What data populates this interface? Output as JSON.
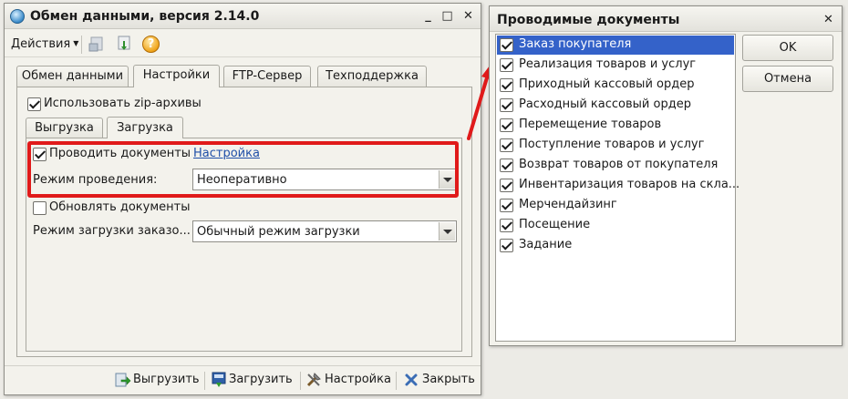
{
  "main_window": {
    "title": "Обмен данными, версия 2.14.0",
    "title_buttons": {
      "minimize": "_",
      "maximize": "□",
      "close": "✕"
    },
    "toolbar": {
      "actions_label": "Действия",
      "help_symbol": "?"
    },
    "tabs": [
      {
        "label": "Обмен данными"
      },
      {
        "label": "Настройки",
        "active": true
      },
      {
        "label": "FTP-Сервер"
      },
      {
        "label": "Техподдержка"
      }
    ],
    "use_zip": {
      "label": "Использовать zip-архивы",
      "checked": true
    },
    "subtabs": [
      {
        "label": "Выгрузка"
      },
      {
        "label": "Загрузка",
        "active": true
      }
    ],
    "post_documents": {
      "label": "Проводить документы",
      "checked": true,
      "link": "Настройка"
    },
    "posting_mode": {
      "label": "Режим проведения:",
      "value": "Неоперативно"
    },
    "update_documents": {
      "label": "Обновлять документы",
      "checked": false
    },
    "order_load_mode": {
      "label": "Режим загрузки заказо...",
      "value": "Обычный режим загрузки"
    },
    "bottom_buttons": {
      "export": "Выгрузить",
      "import": "Загрузить",
      "settings": "Настройка",
      "close": "Закрыть"
    }
  },
  "dialog": {
    "title": "Проводимые документы",
    "close_symbol": "✕",
    "items": [
      {
        "label": "Заказ покупателя",
        "checked": true,
        "selected": true
      },
      {
        "label": "Реализация товаров и услуг",
        "checked": true
      },
      {
        "label": "Приходный кассовый ордер",
        "checked": true
      },
      {
        "label": "Расходный кассовый ордер",
        "checked": true
      },
      {
        "label": "Перемещение товаров",
        "checked": true
      },
      {
        "label": "Поступление товаров и услуг",
        "checked": true
      },
      {
        "label": "Возврат товаров от покупателя",
        "checked": true
      },
      {
        "label": "Инвентаризация товаров на скла...",
        "checked": true
      },
      {
        "label": "Мерчендайзинг",
        "checked": true
      },
      {
        "label": "Посещение",
        "checked": true
      },
      {
        "label": "Задание",
        "checked": true
      }
    ],
    "ok": "OK",
    "cancel": "Отмена"
  },
  "colors": {
    "highlight": "#e01a1a",
    "selection": "#3462c9",
    "link": "#1f4fa8"
  }
}
